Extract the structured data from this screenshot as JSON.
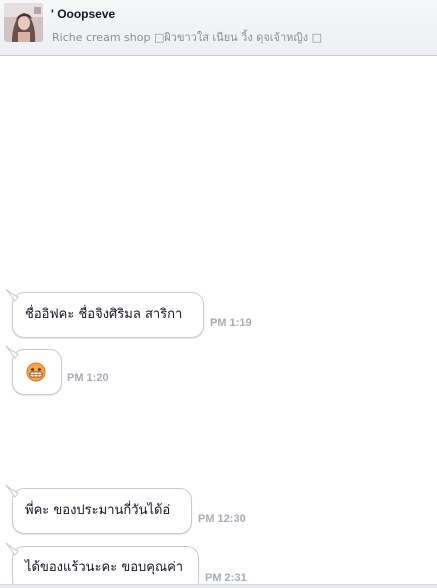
{
  "header": {
    "contact_name": "' Ooopseve",
    "status": "Riche cream shop □ผิวขาวใส เนียน วิ้ง ดุจเจ้าหญิง □"
  },
  "messages": [
    {
      "text": "ชื่ออิฟคะ ชื่อจิงศิริมล สาริกา",
      "time": "PM 1:19"
    },
    {
      "emoji": "grinning-face-emoji",
      "time": "PM 1:20"
    },
    {
      "text": "พี่คะ ของประมานกี่วันได้อ่",
      "time": "PM 12:30"
    },
    {
      "text": "ได้ของแร้วนะคะ ขอบคุณค่า",
      "time": "PM 2:31"
    }
  ],
  "colors": {
    "header_bg": "#edeff3",
    "bubble_border": "#c6cad2",
    "time_text": "#a8acb4"
  }
}
